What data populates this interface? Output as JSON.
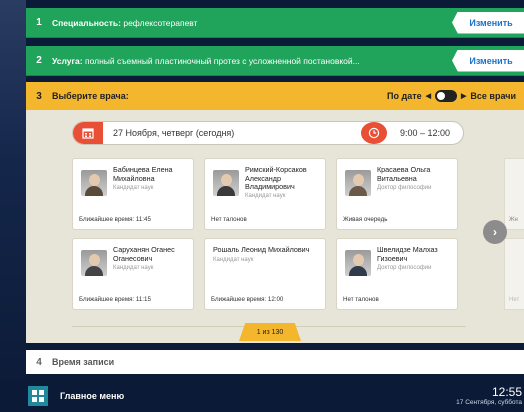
{
  "steps": {
    "step1": {
      "number": "1",
      "label": "Специальность:",
      "value": "рефлексотерапевт",
      "change_label": "Изменить"
    },
    "step2": {
      "number": "2",
      "label": "Услуга:",
      "value": "полный съемный пластиночный протез с усложненной постановкой...",
      "change_label": "Изменить"
    },
    "step3": {
      "number": "3",
      "title": "Выберите врача:",
      "sort_by_date": "По дате",
      "all_doctors": "Все врачи"
    },
    "step4": {
      "number": "4",
      "title": "Время записи"
    }
  },
  "filters": {
    "date": "27 Ноября, четверг (сегодня)",
    "time_range": "9:00 – 12:00"
  },
  "doctors": [
    {
      "name": "Бабинцева Елена Михайловна",
      "degree": "Кандидат наук",
      "nearest": "Ближайшее время: 11:45"
    },
    {
      "name": "Римский-Корсаков Александр Владимирович",
      "degree": "Кандидат наук",
      "nearest": "Нет талонов"
    },
    {
      "name": "Красаева Ольга Витальевна",
      "degree": "Доктор философии",
      "nearest": "Живая очередь"
    },
    {
      "name": "Саруханян Оганес Оганесович",
      "degree": "Кандидат наук",
      "nearest": "Ближайшее время: 11:15"
    },
    {
      "name": "Рошаль Леонид Михайлович",
      "degree": "Кандидат наук",
      "nearest": "Ближайшее время: 12:00"
    },
    {
      "name": "Швелидзе Малхаз Гизоевич",
      "degree": "Доктор философии",
      "nearest": "Нет талонов"
    }
  ],
  "ghost_cards": [
    {
      "text": "Жн"
    },
    {
      "text": "Нет"
    }
  ],
  "pagination": {
    "label": "1 из 130"
  },
  "footer": {
    "main_menu": "Главное меню",
    "time": "12:55",
    "date": "17 Сентября, суббота"
  },
  "colors": {
    "green": "#20a35a",
    "yellow": "#f4b62c",
    "red": "#e94f35",
    "navy": "#0b1a36"
  }
}
